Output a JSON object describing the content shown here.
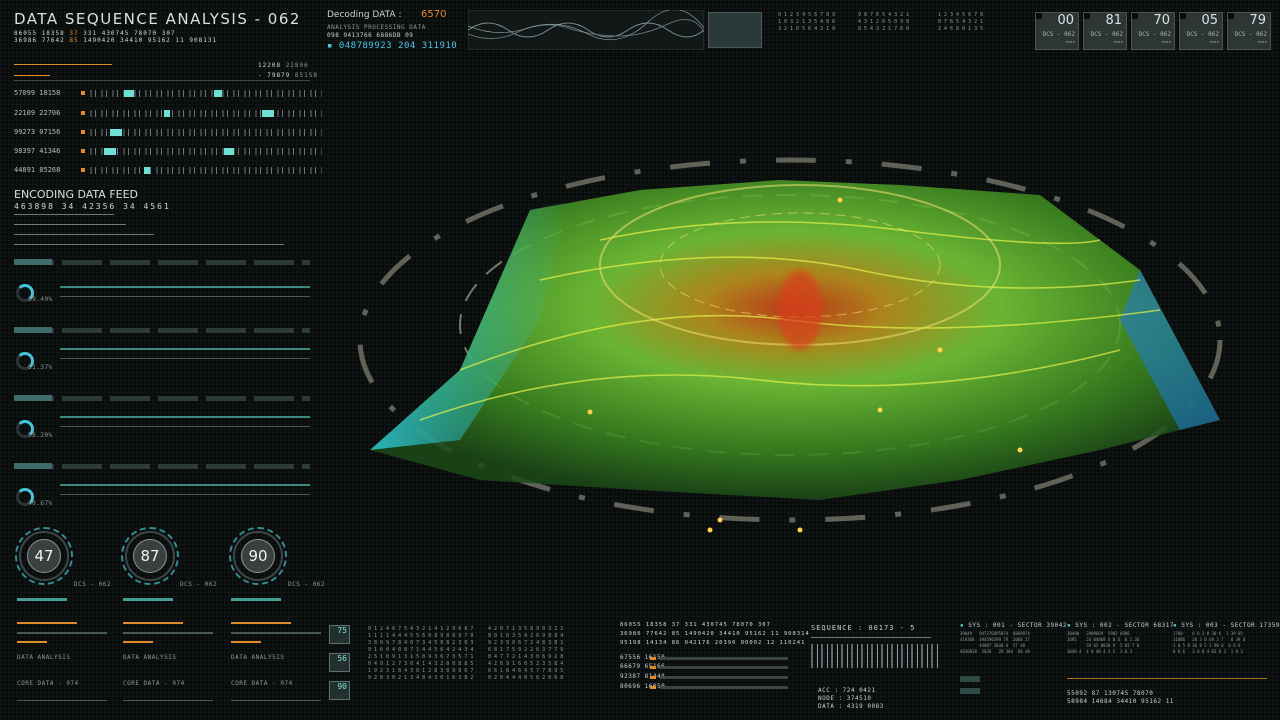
{
  "header": {
    "title": "DATA SEQUENCE ANALYSIS - 062",
    "line1": [
      "86055",
      "18358",
      "37",
      "331",
      "430745",
      "78070",
      "307"
    ],
    "line2": [
      "36986",
      "77642",
      "85",
      "1490420",
      "34410",
      "95162",
      "11",
      "908131"
    ]
  },
  "top_right_counts": {
    "a": "12208",
    "b": "22806",
    "c": "- 79879",
    "d": "85158"
  },
  "sequence_rows": [
    {
      "id": "57099 18158"
    },
    {
      "id": "22109 22706"
    },
    {
      "id": "99273 07156"
    },
    {
      "id": "98397 41346"
    },
    {
      "id": "44891 85268"
    }
  ],
  "encoding": {
    "title": "ENCODING DATA FEED",
    "values": "463898  34 42356  34  4561"
  },
  "sections": [
    {
      "percent": "89.40%"
    },
    {
      "percent": "81.37%"
    },
    {
      "percent": "58.20%"
    },
    {
      "percent": "40.67%"
    }
  ],
  "gauges": [
    {
      "value": "47",
      "code": "DCS - 062"
    },
    {
      "value": "87",
      "code": "DCS - 062"
    },
    {
      "value": "90",
      "code": "DCS - 062"
    }
  ],
  "decoding": {
    "label": "Decoding DATA",
    "colon": ":",
    "value": "6570",
    "sub": "ANALYSIS PROCESSING DATA",
    "codes": "098  9413766  6886DB  09",
    "big": "048789923 204 311910"
  },
  "top_tiles": [
    {
      "value": "00",
      "code": "DCS - 062"
    },
    {
      "value": "81",
      "code": "DCS - 062"
    },
    {
      "value": "70",
      "code": "DCS - 062"
    },
    {
      "value": "05",
      "code": "DCS - 062"
    },
    {
      "value": "79",
      "code": "DCS - 062"
    }
  ],
  "bottom_left_labels": [
    "DATA ANALYSIS",
    "CORE DATA - 074",
    "DATA ANALYSIS",
    "CORE DATA - 074",
    "DATA ANALYSIS",
    "CORE DATA - 074"
  ],
  "side_boxes": [
    "75",
    "56",
    "90"
  ],
  "bottom_center": {
    "line1": "86055  18358  37  331  430745  78070  307",
    "line2": "36986  77642  85  1490420  34410  95162  11  908314",
    "line3": "95198  14134  86  042176  20390  80002  12  110241",
    "rows": [
      "67556  16150",
      "66679  65166",
      "92387  81448",
      "80696  16050"
    ]
  },
  "sequence": {
    "label": "SEQUENCE :",
    "value": "00173 - 5",
    "acc": "ACC : 724 0421",
    "node": "NODE : 374510",
    "data": "DATA : 4319 0083"
  },
  "sys": [
    {
      "label": "SYS : 001 - SECTOR 39042"
    },
    {
      "label": "SYS : 002 - SECTOR 68317"
    },
    {
      "label": "SYS : 003 - SECTOR 17359"
    }
  ],
  "bottom_right": {
    "line1": "55092  87  130745  78070",
    "line2": "58984  14684  34410  95162  11"
  },
  "colors": {
    "accent_cyan": "#4fd6d6",
    "accent_orange": "#e08a2a",
    "terrain_green": "#7ad23a",
    "terrain_red": "#d8401a",
    "terrain_blue": "#1e7cd8"
  }
}
